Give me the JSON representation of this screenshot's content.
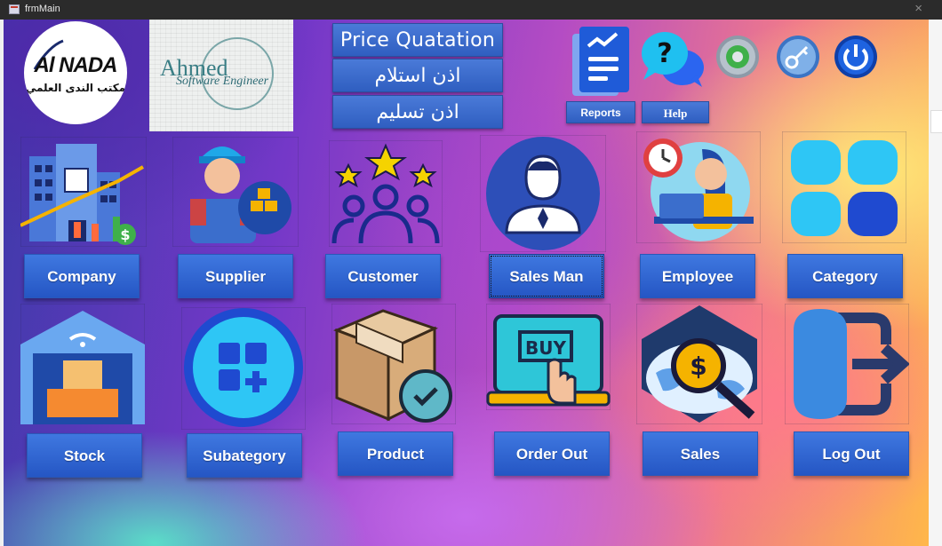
{
  "window": {
    "title": "frmMain",
    "close_glyph": "×"
  },
  "branding": {
    "logo_text": "Al NADA",
    "logo_subtitle_ar": "مكتب الندى العلمي",
    "developer_name": "Ahmed",
    "developer_subtitle": "Software Engineer"
  },
  "top_buttons": {
    "price_quotation": "Price Quatation",
    "receipt_permit": "اذن استلام",
    "delivery_permit": "اذن تسليم"
  },
  "toolbar": {
    "reports_label": "Reports",
    "help_label": "Help",
    "icons": [
      "reports-icon",
      "help-icon",
      "settings-icon",
      "key-icon",
      "power-icon"
    ]
  },
  "tiles": [
    {
      "label": "Company",
      "icon": "company-icon"
    },
    {
      "label": "Supplier",
      "icon": "supplier-icon"
    },
    {
      "label": "Customer",
      "icon": "customer-icon"
    },
    {
      "label": "Sales Man",
      "icon": "salesman-icon"
    },
    {
      "label": "Employee",
      "icon": "employee-icon"
    },
    {
      "label": "Category",
      "icon": "category-icon"
    },
    {
      "label": "Stock",
      "icon": "stock-icon"
    },
    {
      "label": "Subategory",
      "icon": "subcategory-icon"
    },
    {
      "label": "Product",
      "icon": "product-icon"
    },
    {
      "label": "Order Out",
      "icon": "order-out-icon"
    },
    {
      "label": "Sales",
      "icon": "sales-icon"
    },
    {
      "label": "Log Out",
      "icon": "logout-icon"
    }
  ],
  "colors": {
    "button_blue": "#2f5ec0",
    "titlebar": "#2b2b2b"
  }
}
